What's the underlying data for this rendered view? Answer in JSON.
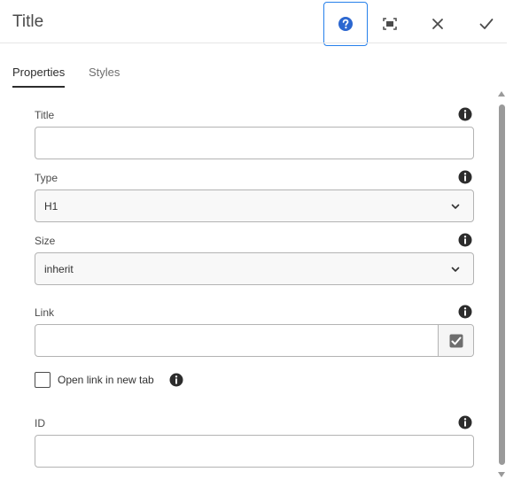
{
  "dialog": {
    "title": "Title"
  },
  "header": {
    "help_icon": "help-icon",
    "fullscreen_icon": "fullscreen-icon",
    "close_icon": "close-icon",
    "done_icon": "checkmark-icon",
    "accent_color": "#2680eb"
  },
  "tabs": [
    {
      "label": "Properties",
      "active": true
    },
    {
      "label": "Styles",
      "active": false
    }
  ],
  "fields": {
    "title": {
      "label": "Title",
      "value": "",
      "info_icon": "info-icon"
    },
    "type": {
      "label": "Type",
      "value": "H1",
      "info_icon": "info-icon"
    },
    "size": {
      "label": "Size",
      "value": "inherit",
      "info_icon": "info-icon"
    },
    "link": {
      "label": "Link",
      "value": "",
      "info_icon": "info-icon",
      "picker_icon": "checkbox-checked-icon"
    },
    "open_new_tab": {
      "label": "Open link in new tab",
      "checked": false,
      "info_icon": "info-icon"
    },
    "id": {
      "label": "ID",
      "value": "",
      "info_icon": "info-icon"
    }
  }
}
